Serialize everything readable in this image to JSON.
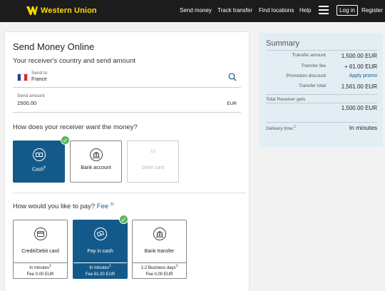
{
  "header": {
    "brand": "Western Union",
    "nav": [
      "Send money",
      "Track transfer",
      "Find locations",
      "Help"
    ],
    "login": "Log in",
    "register": "Register"
  },
  "main": {
    "title": "Send Money Online",
    "section1": "Your receiver's country and send amount",
    "send_to_label": "Send to",
    "send_to_value": "France",
    "amount_label": "Send amount",
    "amount_value": "1500.00",
    "amount_currency": "EUR",
    "section2": "How does your receiver want the money?",
    "receive_options": [
      {
        "label": "Cash",
        "sup": "6",
        "state": "selected"
      },
      {
        "label": "Bank account",
        "sup": "",
        "state": "normal"
      },
      {
        "label": "Debit card",
        "sup": "",
        "state": "disabled",
        "icon_text": "$$"
      }
    ],
    "section3": "How would you like to pay?",
    "fee_link": "Fee",
    "fee_sup": "31",
    "pay_options": [
      {
        "label": "Credit/Debit card",
        "speed": "In minutes",
        "speed_sup": "1",
        "fee": "Fee 0.00  EUR",
        "state": "normal"
      },
      {
        "label": "Pay in cash",
        "speed": "In minutes",
        "speed_sup": "1",
        "fee": "Fee 61.00  EUR",
        "state": "selected"
      },
      {
        "label": "Bank transfer",
        "speed": "1-2 Business days",
        "speed_sup": "1",
        "fee": "Fee 0.00  EUR",
        "state": "normal"
      }
    ]
  },
  "summary": {
    "title": "Summary",
    "rows": [
      {
        "k": "Transfer amount",
        "v": "1,500.00 EUR"
      },
      {
        "k": "Transfer fee",
        "v": "+ 61.00 EUR"
      },
      {
        "k": "Promotion discount",
        "v": "Apply promo"
      },
      {
        "k": "Transfer total",
        "v": "1,561.00 EUR"
      }
    ],
    "receiver_gets_label": "Total Receiver gets",
    "receiver_gets_value": "1,500.00 EUR",
    "delivery_label": "Delivery time:",
    "delivery_sup": "1",
    "delivery_value": "In minutes"
  },
  "colors": {
    "brand_yellow": "#ffdd00",
    "selected_blue": "#135a8a",
    "check_green": "#5cb85c",
    "summary_bg": "#e2eef3"
  }
}
